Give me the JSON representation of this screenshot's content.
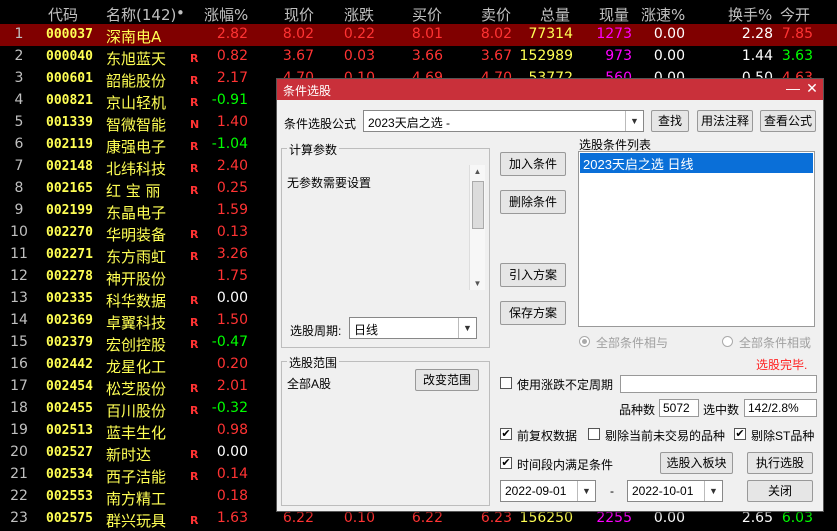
{
  "table": {
    "headers": [
      "代码",
      "名称(142)",
      "•",
      "涨幅%",
      "现价",
      "涨跌",
      "买价",
      "卖价",
      "总量",
      "现量",
      "涨速%",
      "换手%",
      "今开"
    ],
    "rows": [
      {
        "idx": "1",
        "code": "000037",
        "name": "深南电A",
        "tag": "",
        "pct": "2.82",
        "price": "8.02",
        "chg": "0.22",
        "bid": "8.01",
        "ask": "8.02",
        "vol": "77314",
        "cur": "1273",
        "spd": "0.00",
        "turn": "2.28",
        "open": "7.85"
      },
      {
        "idx": "2",
        "code": "000040",
        "name": "东旭蓝天",
        "tag": "R",
        "pct": "0.82",
        "price": "3.67",
        "chg": "0.03",
        "bid": "3.66",
        "ask": "3.67",
        "vol": "152989",
        "cur": "973",
        "spd": "0.00",
        "turn": "1.44",
        "open": "3.63"
      },
      {
        "idx": "3",
        "code": "000601",
        "name": "韶能股份",
        "tag": "R",
        "pct": "2.17",
        "price": "4.70",
        "chg": "0.10",
        "bid": "4.69",
        "ask": "4.70",
        "vol": "53772",
        "cur": "560",
        "spd": "0.00",
        "turn": "0.50",
        "open": "4.63"
      },
      {
        "idx": "4",
        "code": "000821",
        "name": "京山轻机",
        "tag": "R",
        "pct": "-0.91"
      },
      {
        "idx": "5",
        "code": "001339",
        "name": "智微智能",
        "tag": "N",
        "pct": "1.40"
      },
      {
        "idx": "6",
        "code": "002119",
        "name": "康强电子",
        "tag": "R",
        "pct": "-1.04"
      },
      {
        "idx": "7",
        "code": "002148",
        "name": "北纬科技",
        "tag": "R",
        "pct": "2.40"
      },
      {
        "idx": "8",
        "code": "002165",
        "name": "红 宝 丽",
        "tag": "R",
        "pct": "0.25"
      },
      {
        "idx": "9",
        "code": "002199",
        "name": "东晶电子",
        "tag": "",
        "pct": "1.59"
      },
      {
        "idx": "10",
        "code": "002270",
        "name": "华明装备",
        "tag": "R",
        "pct": "0.13"
      },
      {
        "idx": "11",
        "code": "002271",
        "name": "东方雨虹",
        "tag": "R",
        "pct": "3.26"
      },
      {
        "idx": "12",
        "code": "002278",
        "name": "神开股份",
        "tag": "",
        "pct": "1.75"
      },
      {
        "idx": "13",
        "code": "002335",
        "name": "科华数据",
        "tag": "R",
        "pct": "0.00"
      },
      {
        "idx": "14",
        "code": "002369",
        "name": "卓翼科技",
        "tag": "R",
        "pct": "1.50"
      },
      {
        "idx": "15",
        "code": "002379",
        "name": "宏创控股",
        "tag": "R",
        "pct": "-0.47"
      },
      {
        "idx": "16",
        "code": "002442",
        "name": "龙星化工",
        "tag": "",
        "pct": "0.20"
      },
      {
        "idx": "17",
        "code": "002454",
        "name": "松芝股份",
        "tag": "R",
        "pct": "2.01"
      },
      {
        "idx": "18",
        "code": "002455",
        "name": "百川股份",
        "tag": "R",
        "pct": "-0.32"
      },
      {
        "idx": "19",
        "code": "002513",
        "name": "蓝丰生化",
        "tag": "",
        "pct": "0.98"
      },
      {
        "idx": "20",
        "code": "002527",
        "name": "新时达",
        "tag": "R",
        "pct": "0.00"
      },
      {
        "idx": "21",
        "code": "002534",
        "name": "西子洁能",
        "tag": "R",
        "pct": "0.14"
      },
      {
        "idx": "22",
        "code": "002553",
        "name": "南方精工",
        "tag": "",
        "pct": "0.18"
      },
      {
        "idx": "23",
        "code": "002575",
        "name": "群兴玩具",
        "tag": "R",
        "pct": "1.63",
        "price": "6.22",
        "chg": "0.10",
        "bid": "6.22",
        "ask": "6.23",
        "vol": "156250",
        "cur": "2255",
        "spd": "0.00",
        "turn": "2.65",
        "open": "6.03"
      }
    ]
  },
  "colors": {
    "up": "#ff3333",
    "down": "#00ff00",
    "selected_row": "#800000",
    "title_bar": "#c9303a",
    "code": "#ffff54",
    "current_volume": "#ff00ff"
  },
  "dialog": {
    "title": "条件选股",
    "min_glyph": "—",
    "close_glyph": "✕",
    "formula_label": "条件选股公式",
    "formula_value": "2023天启之选 -",
    "find_button": "查找",
    "usage_button": "用法注释",
    "view_formula_button": "查看公式",
    "params_group": "计算参数",
    "params_text": "无参数需要设置",
    "period_label": "选股周期:",
    "period_value": "日线",
    "add_condition": "加入条件",
    "delete_condition": "删除条件",
    "import_scheme": "引入方案",
    "save_scheme": "保存方案",
    "condition_list_label": "选股条件列表",
    "condition_items": [
      "2023天启之选  日线"
    ],
    "and_label": "全部条件相与",
    "or_label": "全部条件相或",
    "done_text": "选股完毕.",
    "range_group": "选股范围",
    "range_value": "全部A股",
    "change_range": "改变范围",
    "use_uncertain_period": "使用涨跌不定周期",
    "count_label": "品种数",
    "count_value": "5072",
    "selected_label": "选中数",
    "selected_value": "142/2.8%",
    "pre_adjust": "前复权数据",
    "exclude_untraded": "剔除当前未交易的品种",
    "exclude_st": "剔除ST品种",
    "time_range_condition": "时间段内满足条件",
    "add_to_sector": "选股入板块",
    "run_select": "执行选股",
    "date_from": "2022-09-01",
    "date_sep": "-",
    "date_to": "2022-10-01",
    "close_button": "关闭",
    "arrow_glyph": "▼",
    "check_glyph": "✔"
  }
}
